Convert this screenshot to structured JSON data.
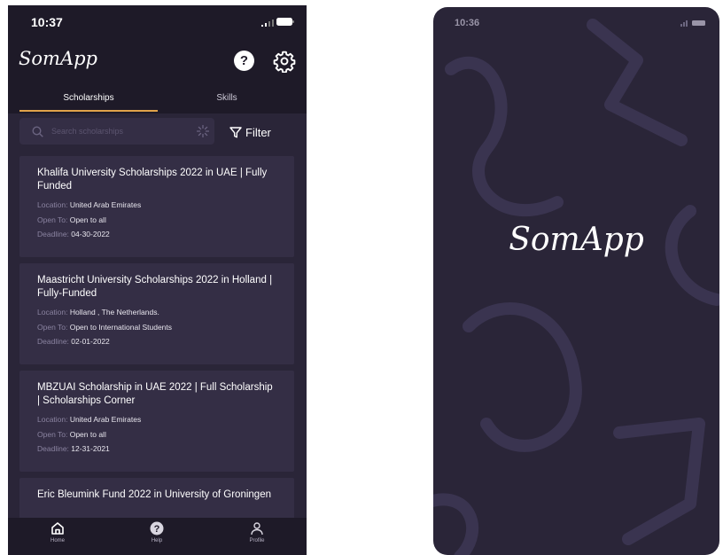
{
  "left_phone": {
    "status_time": "10:37",
    "app_title": "SomApp",
    "help_glyph": "?",
    "tabs": [
      {
        "label": "Scholarships",
        "active": true
      },
      {
        "label": "Skills",
        "active": false
      }
    ],
    "search": {
      "placeholder": "Search scholarships",
      "value": ""
    },
    "filter_label": "Filter",
    "labels": {
      "location": "Location:",
      "open_to": "Open To:",
      "deadline": "Deadline:"
    },
    "scholarships": [
      {
        "title": "Khalifa University Scholarships 2022 in UAE | Fully Funded",
        "location": "United Arab Emirates",
        "open_to": "Open to all",
        "deadline": "04-30-2022"
      },
      {
        "title": "Maastricht University Scholarships 2022 in Holland | Fully-Funded",
        "location": "Holland , The Netherlands.",
        "open_to": "Open to International Students",
        "deadline": "02-01-2022"
      },
      {
        "title": "MBZUAI Scholarship in UAE 2022 | Full Scholarship | Scholarships Corner",
        "location": "United Arab Emirates",
        "open_to": "Open to all",
        "deadline": "12-31-2021"
      },
      {
        "title": "Eric Bleumink Fund 2022 in University of Groningen"
      }
    ],
    "bottom_nav": [
      {
        "label": "Home",
        "icon": "home-icon"
      },
      {
        "label": "Help",
        "icon": "help-icon"
      },
      {
        "label": "Profile",
        "icon": "profile-icon"
      }
    ]
  },
  "right_phone": {
    "status_time": "10:36",
    "splash_title": "SomApp"
  },
  "colors": {
    "background": "#2a2538",
    "header": "#1e1a28",
    "card": "#342e45",
    "accent": "#e0a24a"
  }
}
